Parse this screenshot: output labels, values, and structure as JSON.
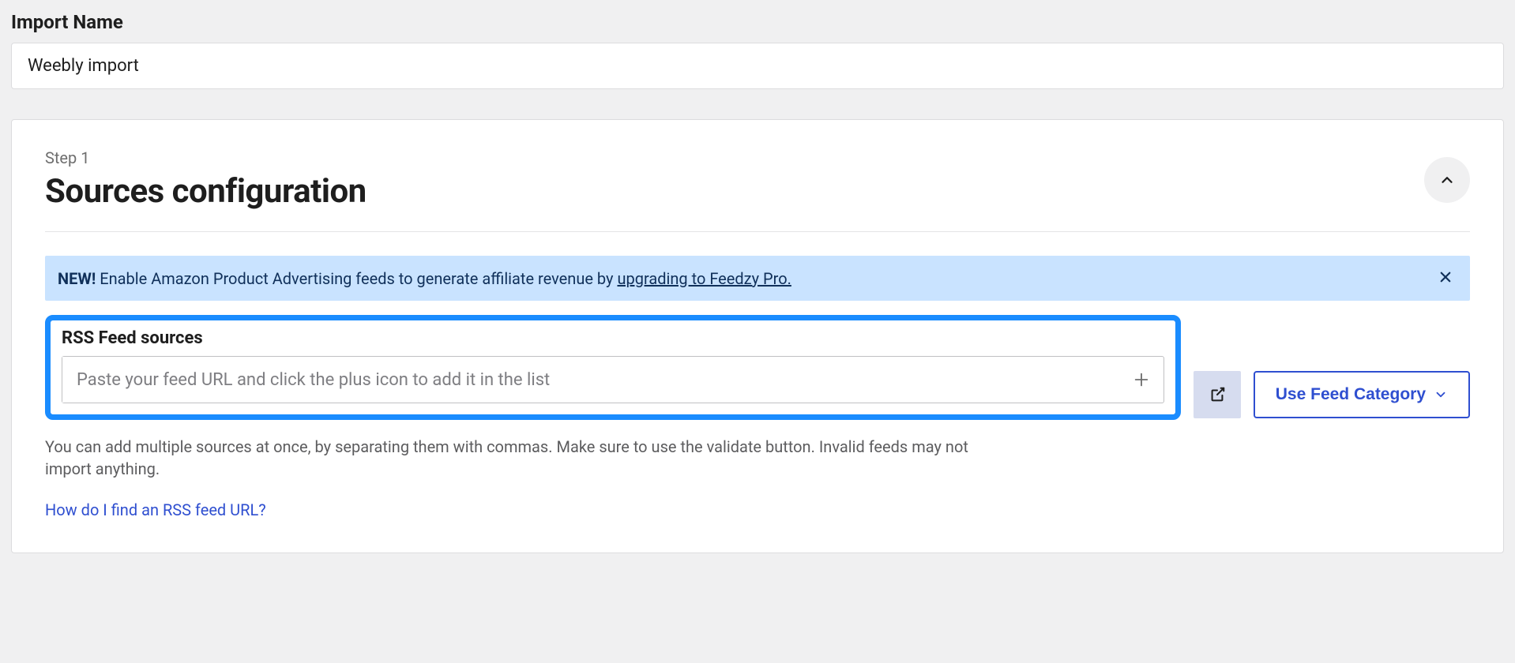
{
  "import_name": {
    "label": "Import Name",
    "value": "Weebly import"
  },
  "step": {
    "label": "Step 1",
    "title": "Sources configuration"
  },
  "banner": {
    "strong": "NEW!",
    "text": " Enable Amazon Product Advertising feeds to generate affiliate revenue by ",
    "link": "upgrading to Feedzy Pro."
  },
  "feed": {
    "label": "RSS Feed sources",
    "placeholder": "Paste your feed URL and click the plus icon to add it in the list",
    "help": "You can add multiple sources at once, by separating them with commas. Make sure to use the validate button. Invalid feeds may not import anything.",
    "find_link": "How do I find an RSS feed URL?"
  },
  "buttons": {
    "use_category": "Use Feed Category"
  }
}
